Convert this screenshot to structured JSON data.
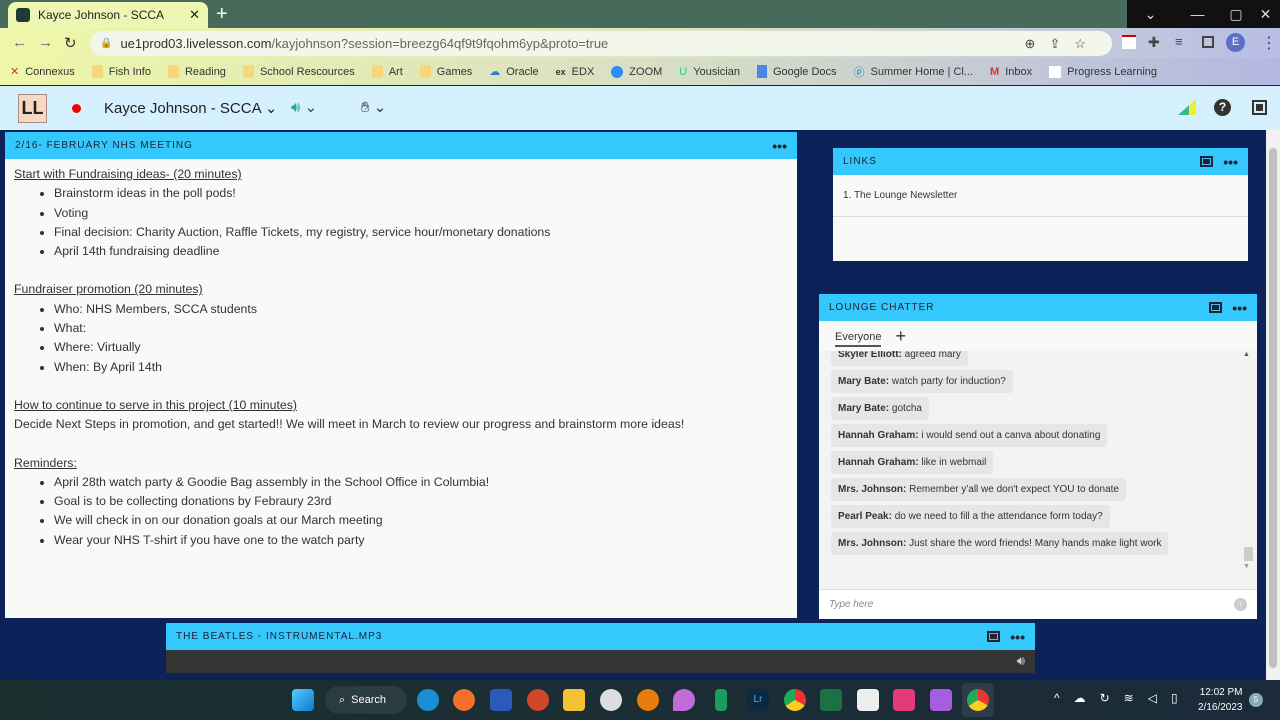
{
  "browser": {
    "tab_title": "Kayce Johnson - SCCA",
    "url_host": "ue1prod03.livelesson.com",
    "url_path": "/kayjohnson?session=breezg64qf9t9fqohm6yp&proto=true",
    "profile_initial": "E",
    "bookmarks": [
      "Connexus",
      "Fish Info",
      "Reading",
      "School Rescources",
      "Art",
      "Games",
      "Oracle",
      "EDX",
      "ZOOM",
      "Yousician",
      "Google Docs",
      "Summer Home | Cl...",
      "Inbox",
      "Progress Learning"
    ]
  },
  "app": {
    "logo": "LL",
    "room_name": "Kayce Johnson - SCCA"
  },
  "notes": {
    "title": "2/16- FEBRUARY NHS MEETING",
    "s1": {
      "heading": "Start with Fundraising ideas- (20 minutes)",
      "items": [
        "Brainstorm ideas in the poll pods!",
        "Voting",
        "Final decision: Charity Auction, Raffle Tickets, my registry, service hour/monetary donations",
        "April 14th fundraising deadline"
      ]
    },
    "s2": {
      "heading": "Fundraiser promotion (20 minutes)",
      "items": [
        "Who: NHS Members, SCCA students",
        "What:",
        "Where: Virtually",
        "When: By April 14th"
      ]
    },
    "s3": {
      "heading": "How to continue to serve in this project (10 minutes)",
      "text": "Decide Next Steps in promotion, and get started!! We will meet in March to review our progress and brainstorm more ideas!"
    },
    "s4": {
      "heading": "Reminders:",
      "items": [
        "April 28th watch party & Goodie Bag assembly in the School Office in Columbia!",
        "Goal is to be collecting donations by Febraury 23rd",
        "We will check in on our donation goals at our March meeting",
        "Wear your NHS T-shirt if you have one to the watch party"
      ]
    }
  },
  "links": {
    "title": "LINKS",
    "items": [
      "1. The Lounge Newsletter"
    ]
  },
  "chat": {
    "title": "LOUNGE CHATTER",
    "tab": "Everyone",
    "placeholder": "Type here",
    "messages": [
      {
        "name": "Skyler Elliott:",
        "text": " agreed mary"
      },
      {
        "name": "Mary Bate:",
        "text": " watch party for induction?"
      },
      {
        "name": "Mary Bate:",
        "text": " gotcha"
      },
      {
        "name": "Hannah Graham:",
        "text": " i would send out a canva about donating"
      },
      {
        "name": "Hannah Graham:",
        "text": " like in webmail"
      },
      {
        "name": "Mrs. Johnson:",
        "text": " Remember y'all we don't expect YOU to donate"
      },
      {
        "name": "Pearl Peak:",
        "text": " do we need to fill a the attendance form today?"
      },
      {
        "name": "Mrs. Johnson:",
        "text": " Just share the word friends! Many hands make light work"
      }
    ]
  },
  "audio": {
    "title": "THE BEATLES - INSTRUMENTAL.MP3"
  },
  "taskbar": {
    "search": "Search",
    "time": "12:02 PM",
    "date": "2/16/2023"
  }
}
